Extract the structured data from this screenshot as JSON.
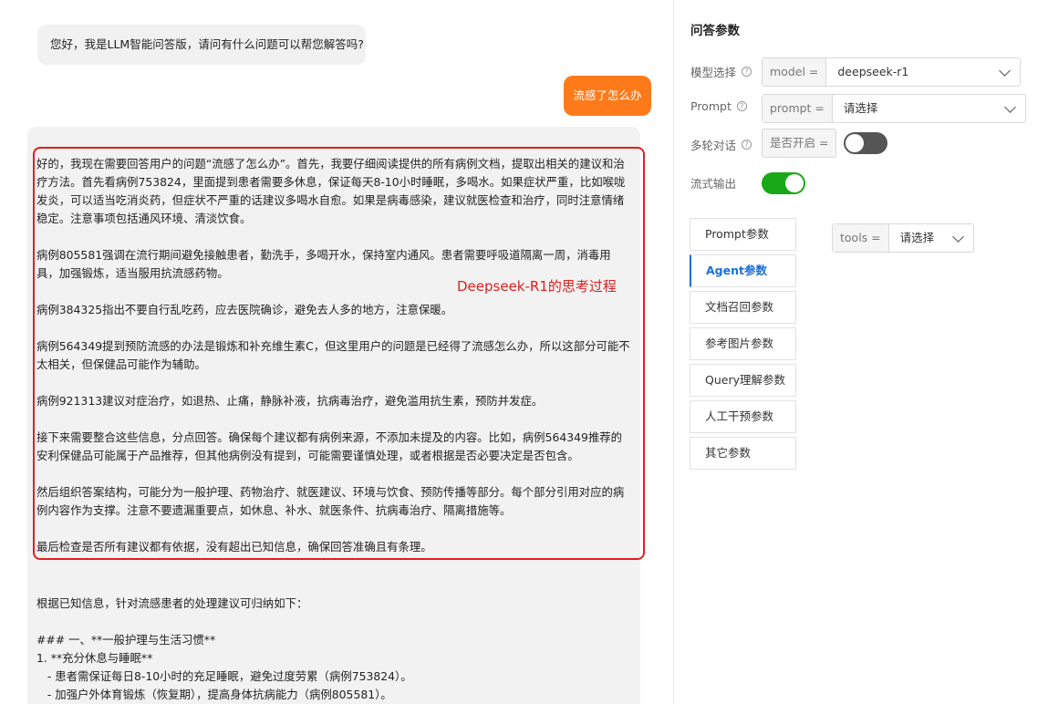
{
  "chat": {
    "greeting": "您好，我是LLM智能问答版，请问有什么问题可以帮您解答吗?",
    "user_message": "流感了怎么办",
    "think_label": "Deepseek-R1的思考过程",
    "think_paragraphs": [
      "好的，我现在需要回答用户的问题“流感了怎么办”。首先，我要仔细阅读提供的所有病例文档，提取出相关的建议和治疗方法。首先看病例753824，里面提到患者需要多休息，保证每天8-10小时睡眠，多喝水。如果症状严重，比如喉咙发炎，可以适当吃消炎药，但症状不严重的话建议多喝水自愈。如果是病毒感染，建议就医检查和治疗，同时注意情绪稳定。注意事项包括通风环境、清淡饮食。",
      "病例805581强调在流行期间避免接触患者，勤洗手，多喝开水，保持室内通风。患者需要呼吸道隔离一周，消毒用具，加强锻炼，适当服用抗流感药物。",
      "病例384325指出不要自行乱吃药，应去医院确诊，避免去人多的地方，注意保暖。",
      "病例564349提到预防流感的办法是锻炼和补充维生素C，但这里用户的问题是已经得了流感怎么办，所以这部分可能不太相关，但保健品可能作为辅助。",
      "病例921313建议对症治疗，如退热、止痛，静脉补液，抗病毒治疗，避免滥用抗生素，预防并发症。",
      "接下来需要整合这些信息，分点回答。确保每个建议都有病例来源，不添加未提及的内容。比如，病例564349推荐的安利保健品可能属于产品推荐，但其他病例没有提到，可能需要谨慎处理，或者根据是否必要决定是否包含。",
      "然后组织答案结构，可能分为一般护理、药物治疗、就医建议、环境与饮食、预防传播等部分。每个部分引用对应的病例内容作为支撑。注意不要遗漏重要点，如休息、补水、就医条件、抗病毒治疗、隔离措施等。",
      "最后检查是否所有建议都有依据，没有超出已知信息，确保回答准确且有条理。"
    ],
    "answer_lines": [
      "根据已知信息，针对流感患者的处理建议可归纳如下：",
      "",
      "### 一、**一般护理与生活习惯**",
      "1. **充分休息与睡眠**",
      "   - 患者需保证每日8-10小时的充足睡眠，避免过度劳累（病例753824）。",
      "   - 加强户外体育锻炼（恢复期），提高身体抗病能力（病例805581）。"
    ]
  },
  "panel": {
    "title": "问答参数",
    "model": {
      "label": "模型选择",
      "addon": "model =",
      "value": "deepseek-r1"
    },
    "prompt": {
      "label": "Prompt",
      "addon": "prompt =",
      "value": "请选择"
    },
    "multi_turn": {
      "label": "多轮对话",
      "addon": "是否开启 =",
      "on": false
    },
    "stream": {
      "label": "流式输出",
      "on": true
    },
    "tabs": [
      "Prompt参数",
      "Agent参数",
      "文档召回参数",
      "参考图片参数",
      "Query理解参数",
      "人工干预参数",
      "其它参数"
    ],
    "active_tab": "Agent参数",
    "tools": {
      "addon": "tools =",
      "value": "请选择"
    }
  }
}
